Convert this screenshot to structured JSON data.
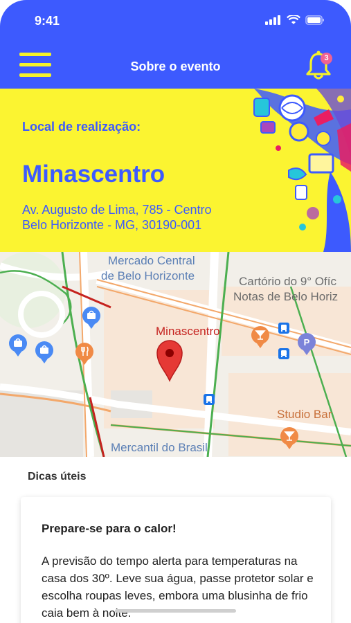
{
  "status_bar": {
    "time": "9:41"
  },
  "header": {
    "title": "Sobre o evento",
    "notification_count": "3"
  },
  "colors": {
    "primary": "#3d5afe",
    "accent": "#fbf431",
    "badge": "#f06292"
  },
  "venue": {
    "label": "Local de realização:",
    "name": "Minascentro",
    "address_line1": "Av. Augusto de Lima, 785 - Centro",
    "address_line2": "Belo Horizonte - MG, 30190-001"
  },
  "map": {
    "labels": {
      "mercado_1": "Mercado Central",
      "mercado_2": "de Belo Horizonte",
      "cartorio_1": "Cartório do 9° Ofíc",
      "cartorio_2": "Notas de Belo Horiz",
      "venue": "Minascentro",
      "studio_bar": "Studio Bar",
      "mercantil": "Mercantil do Brasil"
    }
  },
  "tips": {
    "section_title": "Dicas úteis",
    "card_title": "Prepare-se para o calor!",
    "card_body": "A previsão do tempo alerta para temperaturas na casa dos 30º. Leve sua água, passe protetor solar e escolha roupas leves, embora uma blusinha de frio caia bem à noite."
  }
}
